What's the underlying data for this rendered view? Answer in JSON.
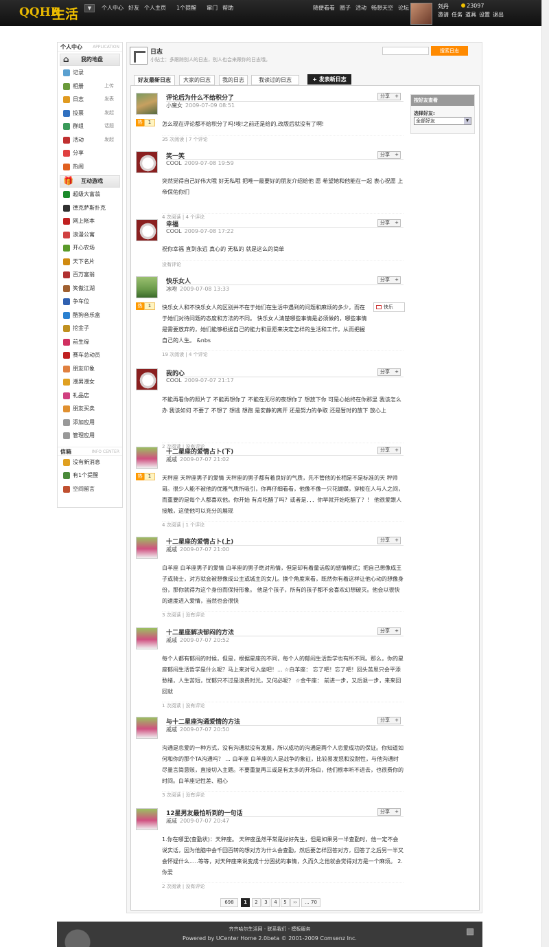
{
  "logo": {
    "q": "QQHR",
    "life": "生活"
  },
  "topnav": [
    "个人中心",
    "好友",
    "个人主页",
    "1个提醒",
    "窜门",
    "帮助"
  ],
  "navright": [
    "随便看看",
    "圈子",
    "活动",
    "畅想天空",
    "论坛"
  ],
  "user": {
    "name": "刘丹",
    "credit": "23097",
    "links": [
      "邀请",
      "任务",
      "道具",
      "设置",
      "退出"
    ]
  },
  "sidebar": {
    "title": "个人中心",
    "title_en": "APPLICATION",
    "head1": "我的地盘",
    "items1": [
      {
        "label": "记录",
        "sub": "",
        "color": "#5aa0d0"
      },
      {
        "label": "相册",
        "sub": "上传",
        "color": "#6a9a3a"
      },
      {
        "label": "日志",
        "sub": "发表",
        "color": "#e09a20"
      },
      {
        "label": "投票",
        "sub": "发起",
        "color": "#3070c0"
      },
      {
        "label": "群组",
        "sub": "话题",
        "color": "#3a9a5a"
      },
      {
        "label": "活动",
        "sub": "发起",
        "color": "#c03030"
      },
      {
        "label": "分享",
        "sub": "",
        "color": "#e04040"
      },
      {
        "label": "热闹",
        "sub": "",
        "color": "#e06020"
      }
    ],
    "head2": "互动游戏",
    "items2": [
      {
        "label": "超级大富翁",
        "color": "#1a8a2a"
      },
      {
        "label": "德克萨斯扑克",
        "color": "#303030"
      },
      {
        "label": "网上帐本",
        "color": "#c02020"
      },
      {
        "label": "浪漫公寓",
        "color": "#d04040"
      },
      {
        "label": "开心农场",
        "color": "#5a9a2a"
      },
      {
        "label": "天下名片",
        "color": "#d08a10"
      },
      {
        "label": "百万富翁",
        "color": "#b03030"
      },
      {
        "label": "笑傲江湖",
        "color": "#a06030"
      },
      {
        "label": "争车位",
        "color": "#3060b0"
      },
      {
        "label": "酷狗音乐盒",
        "color": "#2a80d0"
      },
      {
        "label": "挖金子",
        "color": "#c09020"
      },
      {
        "label": "前生缘",
        "color": "#d03060"
      },
      {
        "label": "赛车总动员",
        "color": "#c02020"
      },
      {
        "label": "朋友印象",
        "color": "#e08040"
      },
      {
        "label": "潮男潮女",
        "color": "#e0a020"
      },
      {
        "label": "礼品店",
        "color": "#d04080"
      },
      {
        "label": "朋友买卖",
        "color": "#e09030"
      },
      {
        "label": "添加应用",
        "color": "#999999"
      },
      {
        "label": "管理应用",
        "color": "#999999"
      }
    ],
    "box_title": "信箱",
    "box_title_en": "INFO CENTER",
    "items3": [
      {
        "label": "没有新消息",
        "color": "#e0a020"
      },
      {
        "label": "有1个提醒",
        "color": "#4a8a3a"
      },
      {
        "label": "空间留言",
        "color": "#c05030"
      }
    ]
  },
  "page": {
    "title": "日志",
    "subtitle": "小贴士：多跟踪别人的日志，别人也会来跟你的日志哦。",
    "search_btn": "搜索日志"
  },
  "tabs": [
    "好友最新日志",
    "大家的日志",
    "我的日志",
    "我读过的日志"
  ],
  "publish": "+ 发表新日志",
  "friends": {
    "title": "按好友查看",
    "label": "选择好友:",
    "selected": "全部好友"
  },
  "entries": [
    {
      "title": "评论后为什么不给积分了",
      "author": "小魔女",
      "time": "2009-07-09 08:51",
      "body": "怎么现在评论都不给积分了吗!唉!之前还是给的,改版后就没有了啊!",
      "stat": "35 次阅读 | 7 个评论",
      "hot": "1"
    },
    {
      "title": "笑一笑",
      "author": "COOL",
      "time": "2009-07-08 19:59",
      "body": "突然觉得自己好伟大哦  好无私哦  把唯一最要好的朋友介绍给他  愿  希望她和他能在一起  衷心祝愿  上帝保佑你们",
      "stat": "4 次阅读 | 4 个评论",
      "hot": ""
    },
    {
      "title": "幸福",
      "author": "COOL",
      "time": "2009-07-08 17:22",
      "body": "祝你幸福  直到永远  真心的  无私的  就是这么的简单",
      "stat": "没有评论",
      "hot": ""
    },
    {
      "title": "快乐女人",
      "author": "冰吻",
      "time": "2009-07-08 13:33",
      "body": "快乐女人和不快乐女人的区别并不在于她们在生活中遇到的问题和麻烦的多少，而在于她们对待问题的态度和方法的不同。        快乐女人清楚哪些事情是必须做的，哪些事情是需要放弃的，她们能够根据自己的能力和意愿来决定怎样的生活和工作，从而把握自己的人生。     &nbs",
      "stat": "19 次阅读 | 4 个评论",
      "hot": "1",
      "tag": "快乐"
    },
    {
      "title": "我的心",
      "author": "COOL",
      "time": "2009-07-07 21:17",
      "body": "不能再看你的照片了  不能再想你了  不能在无尽的夜想你了  想放下你  可是心始终在你那里  我该怎么办  我该如何  不要了  不想了    想逃  想跑  是安静的离开  还是努力的争取  还是暂时的放下  放心上",
      "stat": "2 次阅读 | 没有评论",
      "hot": ""
    },
    {
      "title": "十二星座的爱情占卜(下)",
      "author": "戚戚",
      "time": "2009-07-07 21:02",
      "body": "天秤座  天秤座男子的爱情  天秤座的男子都有着良好的气质，先不管他的长相是不是标准的天  秤帅哥。很少人能不被他的优雅气质所吸引，你再仔细看看，他像不像一只花蝴蝶，穿梭在人与人之间，而重要的是每个人都喜欢他。你开始  有点吃醋了吗？或者是．．．你早就开始吃醋了？！  他很爱跟人接触，这使他可以充分的展现",
      "stat": "4 次阅读 | 1 个评论",
      "hot": "1"
    },
    {
      "title": "十二星座的爱情占卜(上)",
      "author": "戚戚",
      "time": "2009-07-07 21:00",
      "body": "白羊座  白羊座男子的爱情  白羊座的男子绝对热情，但是却有着童话般的感情模式；把自己想像成王子或骑士，对方就会被想像成公主或城主的女儿。换个角度来看，既然你有着这样让他心动的想像身份，那你就得为这个身份而保持形象。  他是个孩子，所有的孩子都不会喜欢幻想破灭。他会以很快的速度进入爱情，当然也会很快",
      "stat": "3 次阅读 | 没有评论",
      "hot": ""
    },
    {
      "title": "十二星座解决郁闷的方法",
      "author": "戚戚",
      "time": "2009-07-07 20:52",
      "body": "每个人都有郁闷的时候，但是，根据星座的不同，每个人的郁闷生活哲学也有所不同。那么，你的星座郁闷生活哲学是什么呢？马上来对号入坐吧！...        ☆白羊座：  忘了吧！忘了吧！回头苦思只会平添愁绪，人生苦短，忧郁只不过是浪费时光，又何必呢？           ☆金牛座：   前进一步，又后退一步，来来回回就",
      "stat": "1 次阅读 | 没有评论",
      "hot": ""
    },
    {
      "title": "与十二星座沟通爱情的方法",
      "author": "戚戚",
      "time": "2009-07-07 20:50",
      "body": "沟通是恋爱的一种方式，没有沟通就没有发展，所以成功的沟通是两个人恋爱成功的保证。你知道如何和你的那个TA沟通吗？  ... 白羊座  白羊座的人是战争的象征，比较易发怒和没耐性，与他沟通时尽量言简意赅，直接切入主题。不要重复再三或是有太多的开场白，他们根本听不进去，也很费你的时间。白羊座记性差、粗心",
      "stat": "3 次阅读 | 没有评论",
      "hot": ""
    },
    {
      "title": "12星男友最怕听到的一句话",
      "author": "戚戚",
      "time": "2009-07-07 20:47",
      "body": "1.你在哪里(查勤状)：天秤座。         天秤座虽然平常是好好先生，但是如果另一半查勤时，他一定不会说实话，因为他脑中会千回百转的想对方为什么会查勤，然后要怎样回答对方，回答了之后另一半又会怀疑什么.....等等，对天秤座来说变成十分困扰的事情，久而久之他就会觉得对方是一个麻烦。  2.你爱",
      "stat": "2 次阅读 | 没有评论",
      "hot": ""
    }
  ],
  "share_label": "分享",
  "hot_label": "热",
  "pager": [
    "698",
    "1",
    "2",
    "3",
    "4",
    "5",
    "››",
    "... 70"
  ],
  "footer": {
    "line1": "齐齐哈尔生活网 - 联系我们 - 模板服务",
    "line2": "Powered by UCenter Home 2.0beta © 2001-2009 Comsenz Inc."
  }
}
